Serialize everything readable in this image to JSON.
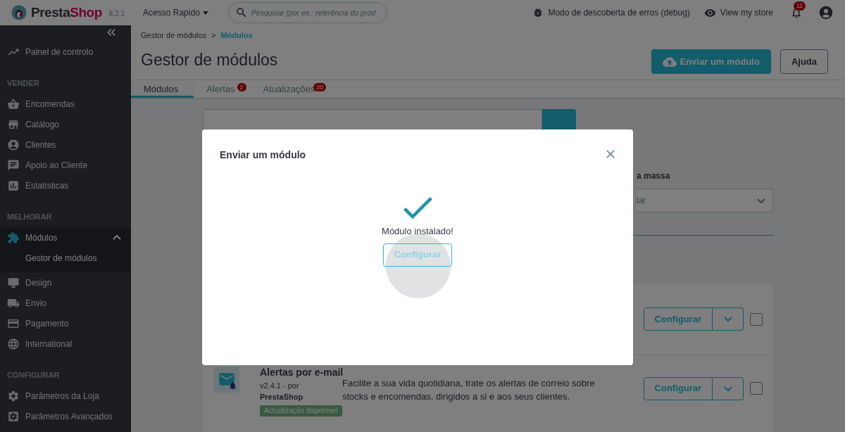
{
  "header": {
    "logo": [
      "Presta",
      "Shop"
    ],
    "version": "8.2.1",
    "quick_access": "Acesso Rapido",
    "search": {
      "placeholder": "Pesquisar (por ex.: referência do prod"
    },
    "debug": "Modo de descoberta de erros (debug)",
    "view_store": "View my store",
    "notifications": "11"
  },
  "sidebar": {
    "sections": [
      {
        "items": [
          {
            "label": "Painel de controlo",
            "selected": false
          }
        ]
      },
      {
        "heading": "VENDER",
        "items": [
          {
            "label": "Encomendas",
            "selected": false
          },
          {
            "label": "Catálogo",
            "selected": false
          },
          {
            "label": "Clientes",
            "selected": false
          },
          {
            "label": "Apoio ao Cliente",
            "selected": false
          },
          {
            "label": "Estatísticas",
            "selected": false
          }
        ]
      },
      {
        "heading": "MELHORAR",
        "items": [
          {
            "label": "Módulos",
            "selected": true,
            "expanded": true,
            "children": [
              {
                "label": "Gestor de módulos",
                "selected": true
              }
            ]
          },
          {
            "label": "Design",
            "selected": false
          },
          {
            "label": "Envio",
            "selected": false
          },
          {
            "label": "Pagamento",
            "selected": false
          },
          {
            "label": "International",
            "selected": false
          }
        ]
      },
      {
        "heading": "CONFIGURAR",
        "items": [
          {
            "label": "Parâmetros da Loja",
            "selected": false
          },
          {
            "label": "Parâmetros Avançados",
            "selected": false
          }
        ]
      }
    ]
  },
  "breadcrumb": {
    "separator": ">",
    "items": [
      {
        "label": "Gestor de módulos",
        "selected": false
      },
      {
        "label": "Módulos",
        "selected": true
      }
    ]
  },
  "page": {
    "title": "Gestor de módulos",
    "buttons": [
      {
        "label": "Enviar um módulo",
        "kind": "primary"
      },
      {
        "label": "Ajuda",
        "kind": "outline"
      }
    ]
  },
  "tabs": [
    {
      "label": "Módulos",
      "selected": true
    },
    {
      "label": "Alertas",
      "badge": "2",
      "selected": false
    },
    {
      "label": "Atualizações",
      "badge": "20",
      "selected": false
    }
  ],
  "filters": {
    "bulk_label": "a massa",
    "bulk_select": "lar"
  },
  "modules": [
    {
      "configure": "Configurar",
      "checked": false
    },
    {
      "name": "Alertas por e-mail",
      "version": "v2.4.1 - por",
      "author": "PrestaShop",
      "badge": "Actualização disponível",
      "description": "Facilite a sua vida quotidiana, trate os alertas de correio sobre stocks e encomendas, dirigidos a si e aos seus clientes.",
      "configure": "Configurar",
      "checked": false
    }
  ],
  "modal": {
    "title": "Enviar um módulo",
    "message": "Módulo instalado!",
    "button": "Configurar"
  }
}
